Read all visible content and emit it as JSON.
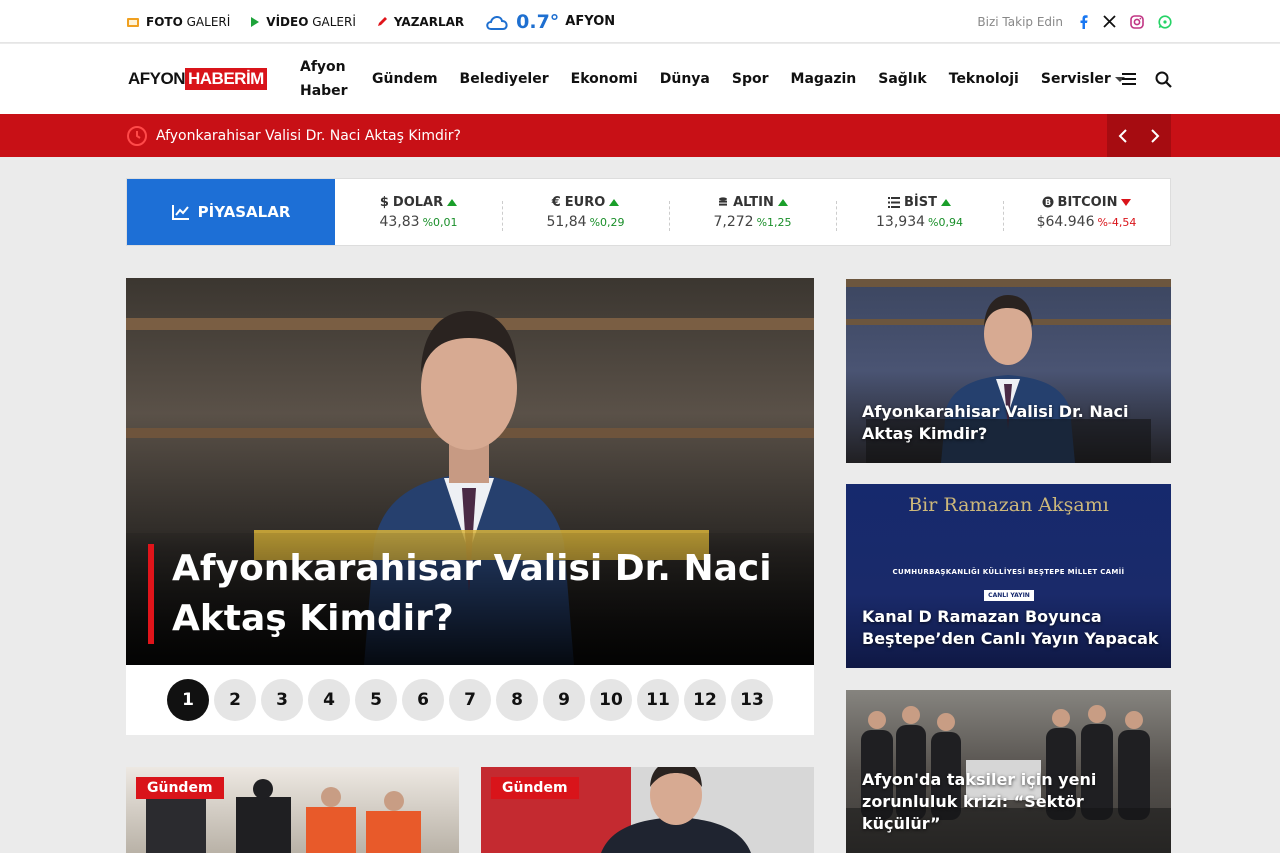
{
  "topbar": {
    "foto_bold": "FOTO",
    "foto_light": "GALERİ",
    "video_bold": "VİDEO",
    "video_light": "GALERİ",
    "yazarlar": "YAZARLAR",
    "weather_temp": "0.7°",
    "weather_city": "AFYON",
    "follow_text": "Bizi Takip Edin"
  },
  "logo": {
    "part1": "AFYON",
    "part2": "HABERİM"
  },
  "nav": {
    "items": [
      "Afyon Haber",
      "Gündem",
      "Belediyeler",
      "Ekonomi",
      "Dünya",
      "Spor",
      "Magazin",
      "Sağlık",
      "Teknoloji",
      "Servisler"
    ]
  },
  "breaking": {
    "text": "Afyonkarahisar Valisi Dr. Naci Aktaş Kimdir?"
  },
  "markets": {
    "title": "PİYASALAR",
    "items": [
      {
        "symbol": "$",
        "name": "DOLAR",
        "value": "43,83",
        "change": "%0,01",
        "dir": "up"
      },
      {
        "symbol": "€",
        "name": "EURO",
        "value": "51,84",
        "change": "%0,29",
        "dir": "up"
      },
      {
        "symbol": "",
        "name": "ALTIN",
        "value": "7,272",
        "change": "%1,25",
        "dir": "up"
      },
      {
        "symbol": "",
        "name": "BİST",
        "value": "13,934",
        "change": "%0,94",
        "dir": "up"
      },
      {
        "symbol": "",
        "name": "BITCOIN",
        "value": "$64.946",
        "change": "%-4,54",
        "dir": "down"
      }
    ]
  },
  "slider": {
    "title": "Afyonkarahisar Valisi Dr. Naci Aktaş Kimdir?",
    "pages": [
      "1",
      "2",
      "3",
      "4",
      "5",
      "6",
      "7",
      "8",
      "9",
      "10",
      "11",
      "12",
      "13"
    ],
    "active_page": "1"
  },
  "side": [
    {
      "title": "Afyonkarahisar Valisi Dr. Naci Aktaş Kimdir?"
    },
    {
      "title": "Kanal D Ramazan Boyunca Beştepe’den Canlı Yayın Yapacak",
      "image_heading": "Bir Ramazan Akşamı",
      "image_sub": "CUMHURBAŞKANLIĞI KÜLLİYESİ BEŞTEPE MİLLET CAMİİ",
      "image_live": "CANLI YAYIN"
    },
    {
      "title": "Afyon'da taksiler için yeni zorunluluk krizi: “Sektör küçülür”"
    }
  ],
  "bottom": [
    {
      "badge": "Gündem"
    },
    {
      "badge": "Gündem"
    }
  ],
  "colors": {
    "brand_red": "#d9141a",
    "markets_blue": "#1d6fd6",
    "up_green": "#1a9f2a"
  }
}
